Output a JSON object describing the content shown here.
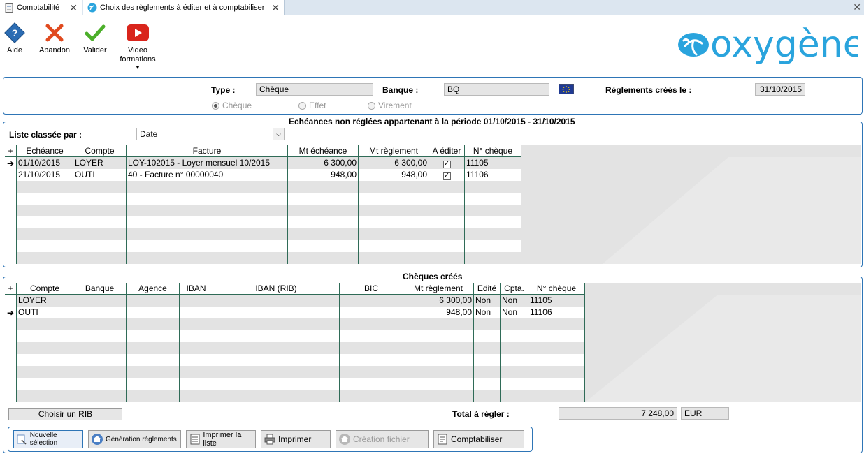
{
  "tabs": [
    {
      "label": "Comptabilité"
    },
    {
      "label": "Choix des règlements à éditer et à comptabiliser"
    }
  ],
  "toolbar": {
    "help": "Aide",
    "cancel": "Abandon",
    "validate": "Valider",
    "video": "Vidéo formations"
  },
  "logo": "oxygène",
  "criteria": {
    "type_label": "Type :",
    "type_value": "Chèque",
    "bank_label": "Banque :",
    "bank_value": "BQ",
    "created_label": "Règlements créés le :",
    "created_value": "31/10/2015",
    "radios": [
      {
        "label": "Chèque",
        "checked": true
      },
      {
        "label": "Effet",
        "checked": false
      },
      {
        "label": "Virement",
        "checked": false
      }
    ]
  },
  "due": {
    "title": "Echéances non réglées appartenant à la période 01/10/2015 - 31/10/2015",
    "sort_label": "Liste classée par :",
    "sort_value": "Date",
    "columns": [
      "Echéance",
      "Compte",
      "Facture",
      "Mt échéance",
      "Mt règlement",
      "A éditer",
      "N° chèque"
    ],
    "rows": [
      {
        "date": "01/10/2015",
        "account": "LOYER",
        "invoice": "LOY-102015 - Loyer mensuel 10/2015",
        "amount_due": "6 300,00",
        "amount_paid": "6 300,00",
        "to_print": true,
        "cheque": "11105"
      },
      {
        "date": "21/10/2015",
        "account": "OUTI",
        "invoice": "40 - Facture n° 00000040",
        "amount_due": "948,00",
        "amount_paid": "948,00",
        "to_print": true,
        "cheque": "11106"
      }
    ]
  },
  "cheques": {
    "title": "Chèques créés",
    "columns": [
      "Compte",
      "Banque",
      "Agence",
      "IBAN",
      "IBAN (RIB)",
      "BIC",
      "Mt règlement",
      "Edité",
      "Cpta.",
      "N° chèque"
    ],
    "rows": [
      {
        "account": "LOYER",
        "amount": "6 300,00",
        "printed": "Non",
        "posted": "Non",
        "cheque": "11105"
      },
      {
        "account": "OUTI",
        "amount": "948,00",
        "printed": "Non",
        "posted": "Non",
        "cheque": "11106"
      }
    ],
    "choose_rib": "Choisir un RIB",
    "total_label": "Total à régler :",
    "total_value": "7 248,00",
    "currency": "EUR"
  },
  "actions": {
    "new_selection": "Nouvelle sélection",
    "generate": "Génération règlements",
    "print_list": "Imprimer la liste",
    "print": "Imprimer",
    "create_file": "Création fichier",
    "post": "Comptabiliser"
  }
}
